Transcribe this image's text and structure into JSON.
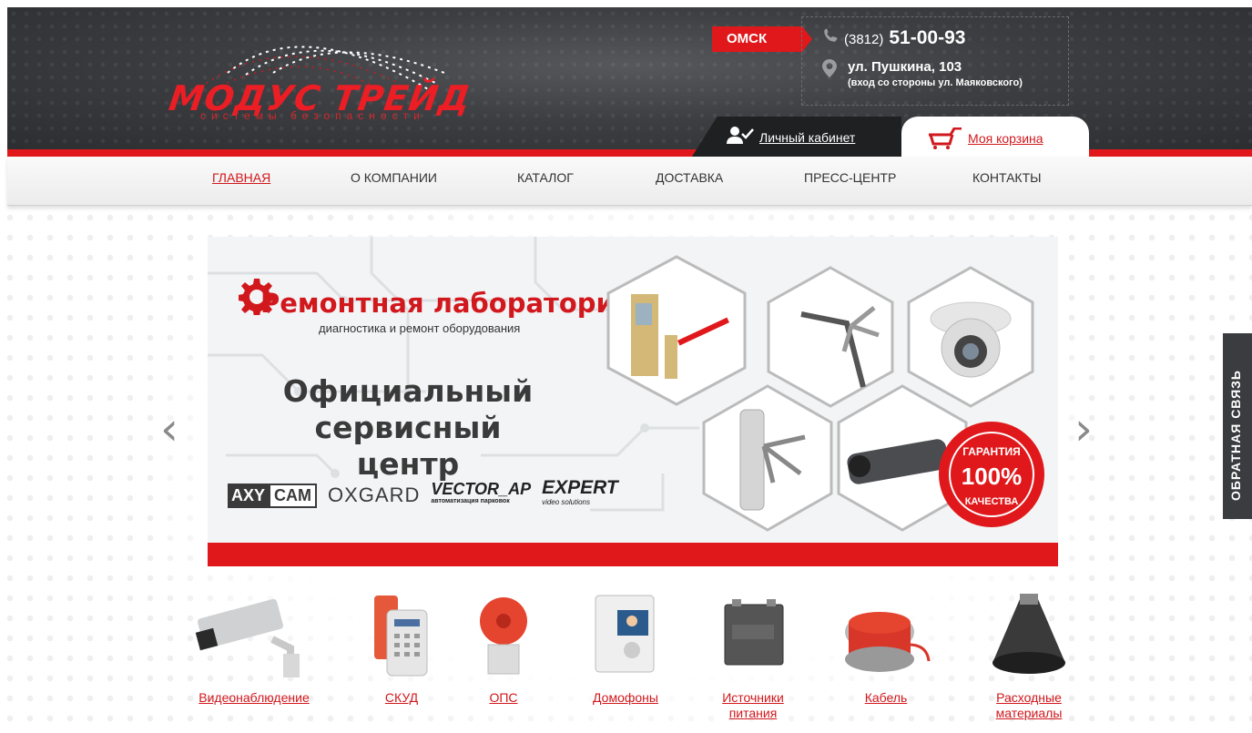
{
  "logo": {
    "name_part1": "МОДУС",
    "name_part2": "ТРЕЙД",
    "tagline": "системы безопасности"
  },
  "header": {
    "city": "ОМСК",
    "phone_code": "(3812)",
    "phone_number": "51-00-93",
    "address": "ул. Пушкина, 103",
    "address_note": "(вход со стороны ул. Маяковского)",
    "cabinet_label": "Личный кабинет",
    "cart_label": "Моя корзина"
  },
  "nav": {
    "items": [
      {
        "label": "ГЛАВНАЯ",
        "active": true
      },
      {
        "label": "О КОМПАНИИ"
      },
      {
        "label": "КАТАЛОГ"
      },
      {
        "label": "ДОСТАВКА"
      },
      {
        "label": "ПРЕСС-ЦЕНТР"
      },
      {
        "label": "КОНТАКТЫ"
      }
    ]
  },
  "banner": {
    "lab_title": "Ремонтная лаборатория",
    "lab_subtitle": "диагностика и ремонт оборудования",
    "headline_line1": "Официальный",
    "headline_line2": "сервисный центр",
    "brands": {
      "axy_part1": "AXY",
      "axy_part2": "CAM",
      "oxgard": "OXGARD",
      "vector": "VECTOR_AP",
      "vector_sub": "автоматизация парковок",
      "expert": "EXPERT",
      "expert_sub": "video solutions"
    },
    "badge_line1": "ГАРАНТИЯ",
    "badge_line2": "100%",
    "badge_line3": "КАЧЕСТВА"
  },
  "slider_controls": {
    "prev": "‹",
    "next": "›"
  },
  "feedback_tab": "ОБРАТНАЯ СВЯЗЬ",
  "categories": [
    {
      "line1": "Видеонаблюдение",
      "line2": ""
    },
    {
      "line1": "СКУД",
      "line2": ""
    },
    {
      "line1": "ОПС",
      "line2": ""
    },
    {
      "line1": "Домофоны",
      "line2": ""
    },
    {
      "line1": "Источники",
      "line2": "питания"
    },
    {
      "line1": "Кабель",
      "line2": ""
    },
    {
      "line1": "Расходные",
      "line2": "материалы"
    }
  ],
  "colors": {
    "accent": "#e0181b",
    "header_dark": "#3c3e42",
    "link": "#d1181d"
  }
}
